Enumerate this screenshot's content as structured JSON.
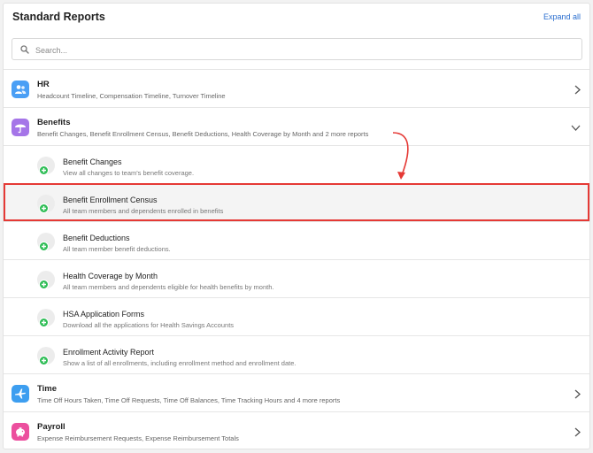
{
  "header": {
    "title": "Standard Reports",
    "expand_all": "Expand all"
  },
  "search": {
    "placeholder": "Search..."
  },
  "categories": {
    "hr": {
      "title": "HR",
      "subtitle": "Headcount Timeline, Compensation Timeline, Turnover Timeline",
      "color": "#4a9ff5",
      "icon": "people-icon"
    },
    "benefits": {
      "title": "Benefits",
      "subtitle": "Benefit Changes, Benefit Enrollment Census, Benefit Deductions, Health Coverage by Month and 2 more reports",
      "color": "#a575e8",
      "icon": "umbrella-icon"
    },
    "time": {
      "title": "Time",
      "subtitle": "Time Off Hours Taken, Time Off Requests, Time Off Balances, Time Tracking Hours and 4 more reports",
      "color": "#3d9ef0",
      "icon": "airplane-icon"
    },
    "payroll": {
      "title": "Payroll",
      "subtitle": "Expense Reimbursement Requests, Expense Reimbursement Totals",
      "color": "#ec4f9e",
      "icon": "piggy-bank-icon"
    }
  },
  "benefit_reports": [
    {
      "title": "Benefit Changes",
      "desc": "View all changes to team's benefit coverage."
    },
    {
      "title": "Benefit Enrollment Census",
      "desc": "All team members and dependents enrolled in benefits"
    },
    {
      "title": "Benefit Deductions",
      "desc": "All team member benefit deductions."
    },
    {
      "title": "Health Coverage by Month",
      "desc": "All team members and dependents eligible for health benefits by month."
    },
    {
      "title": "HSA Application Forms",
      "desc": "Download all the applications for Health Savings Accounts"
    },
    {
      "title": "Enrollment Activity Report",
      "desc": "Show a list of all enrollments, including enrollment method and enrollment date."
    }
  ],
  "colors": {
    "accent": "#2a6ecf",
    "highlight": "#e53935",
    "add_badge": "#2fbd56"
  }
}
